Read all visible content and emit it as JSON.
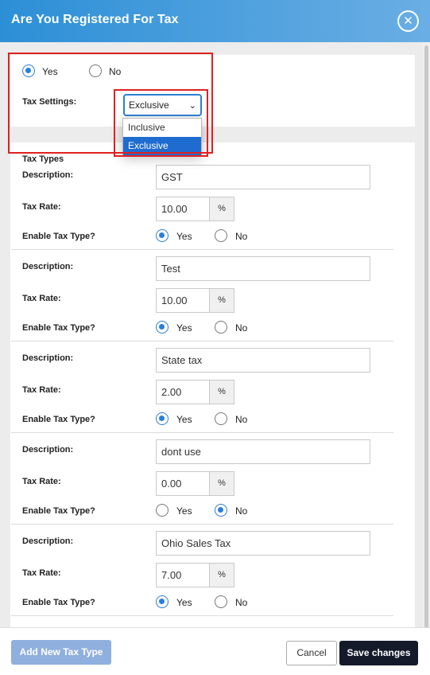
{
  "dialog": {
    "title": "Are You Registered For Tax"
  },
  "registered": {
    "yes_label": "Yes",
    "no_label": "No",
    "selected": "Yes"
  },
  "tax_settings": {
    "label": "Tax Settings:",
    "value": "Exclusive",
    "options": [
      "Inclusive",
      "Exclusive"
    ]
  },
  "tax_types_heading": "Tax Types",
  "field_labels": {
    "description": "Description:",
    "tax_rate": "Tax Rate:",
    "enable": "Enable Tax Type?",
    "percent": "%",
    "yes": "Yes",
    "no": "No"
  },
  "tax_types": [
    {
      "description": "GST",
      "rate": "10.00",
      "enabled": "Yes"
    },
    {
      "description": "Test",
      "rate": "10.00",
      "enabled": "Yes"
    },
    {
      "description": "State tax",
      "rate": "2.00",
      "enabled": "Yes"
    },
    {
      "description": "dont use",
      "rate": "0.00",
      "enabled": "No"
    },
    {
      "description": "Ohio Sales Tax",
      "rate": "7.00",
      "enabled": "Yes"
    }
  ],
  "footer": {
    "add_label": "Add New Tax Type",
    "cancel_label": "Cancel",
    "save_label": "Save changes"
  },
  "colors": {
    "header_start": "#2c8fd6",
    "header_end": "#6aaee4",
    "accent": "#2b7fd4",
    "annotation": "#e02020",
    "save_button": "#141a2a"
  }
}
